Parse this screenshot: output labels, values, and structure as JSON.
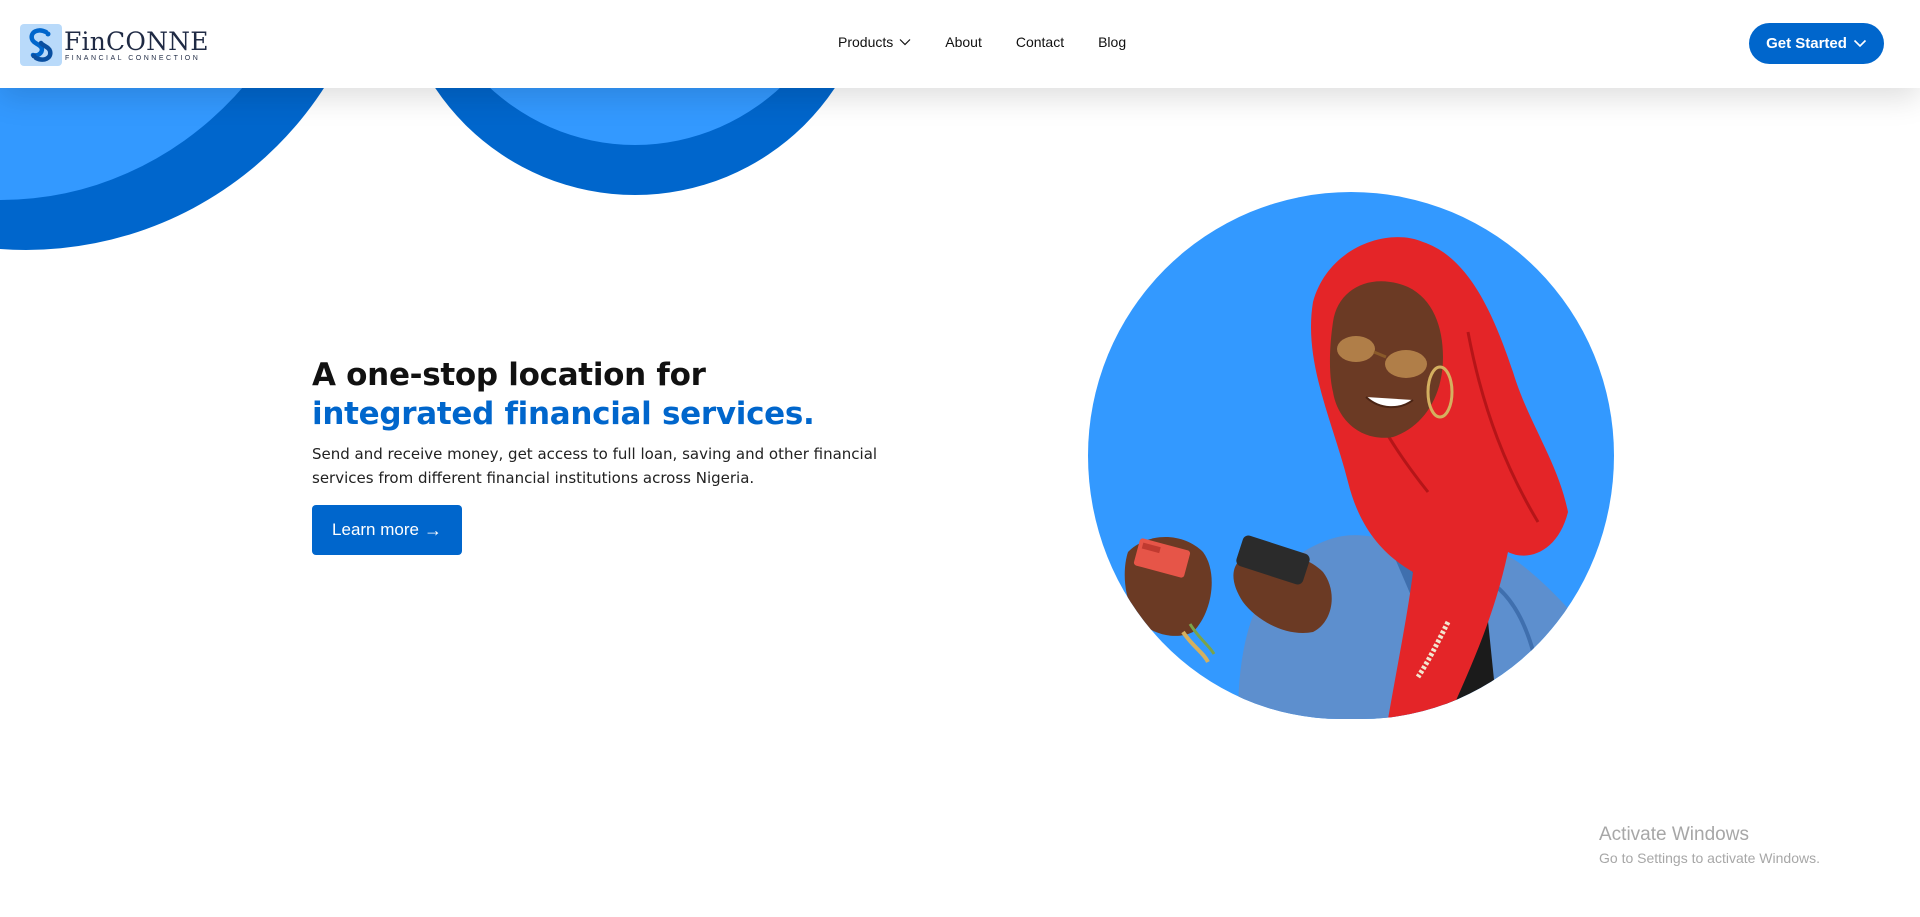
{
  "header": {
    "logo": {
      "name": "FinCONNE",
      "tagline": "FINANCIAL CONNECTION",
      "icon": "chain-link-icon"
    },
    "nav": [
      {
        "label": "Products",
        "has_dropdown": true
      },
      {
        "label": "About"
      },
      {
        "label": "Contact"
      },
      {
        "label": "Blog"
      }
    ],
    "cta_label": "Get Started"
  },
  "hero": {
    "title_line1": "A one-stop location for",
    "title_line2": "integrated financial services.",
    "description": "Send and receive money, get access to full loan, saving and other financial services from different financial institutions across Nigeria.",
    "button_label": "Learn more",
    "button_icon": "arrow-right-icon",
    "image_subject": "woman-with-phone-and-card-photo"
  },
  "watermark": {
    "title": "Activate Windows",
    "subtitle": "Go to Settings to activate Windows."
  },
  "colors": {
    "primary": "#0066cc",
    "light_blue": "#3399ff",
    "text": "#111111"
  }
}
